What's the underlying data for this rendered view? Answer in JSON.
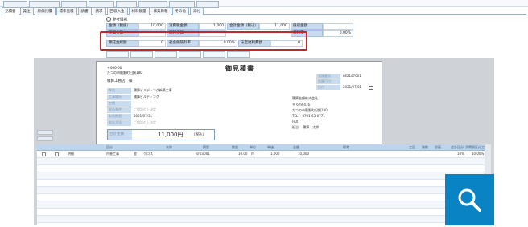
{
  "tabs": [
    "見積書",
    "発注",
    "原価見積",
    "標準見積",
    "請書",
    "請求",
    "回収入金",
    "材料数量",
    "作業日報",
    "その他",
    "添付"
  ],
  "section_toggle_label": "参考情報",
  "reference_fields": [
    {
      "label": "金額（税抜）",
      "value": "10,000"
    },
    {
      "label": "消費税金額",
      "value": "1,000"
    },
    {
      "label": "合計金額（税込）",
      "value": "11,000"
    },
    {
      "label": "値引金額",
      "value": ""
    },
    {
      "label": "原価金額",
      "value": ""
    },
    {
      "label": "粗利金額",
      "value": ""
    },
    {
      "label": "粗利率",
      "value": "0.00%"
    }
  ],
  "highlight_fields": [
    {
      "label": "預託金総額",
      "value": "0"
    },
    {
      "label": "社会保険料率",
      "value": "0.00%"
    },
    {
      "label": "法定福利費額",
      "value": "0"
    }
  ],
  "document": {
    "title": "御見積書",
    "address_line1": "〒000-00",
    "address_line2": "たつの市龍野町日飼180",
    "recipient": "積算工務店　様",
    "fields": [
      {
        "label": "件名",
        "value": "積算ビルディング新築工事"
      },
      {
        "label": "工事場所",
        "value": "積算ビルディング"
      },
      {
        "label": "工期",
        "value": ""
      },
      {
        "label": "支払条件",
        "value": "ご相談の上決定"
      },
      {
        "label": "有効期限",
        "value": "2021/07/31"
      },
      {
        "label": "支払方法",
        "value": "ご相談の上決定"
      }
    ],
    "meta": [
      {
        "label": "見積番号",
        "value": "PE2107001"
      },
      {
        "label": "見積日付",
        "value": ""
      },
      {
        "label": "日付",
        "value": "2021/07/01"
      }
    ],
    "company": {
      "name": "積算金額株式会社",
      "postal": "〒 679-4167",
      "address": "たつの市龍野町日飼180",
      "tel": "TEL： 0791-63-0771",
      "fax": "FAX：",
      "contact": "担当： 積算　太郎"
    },
    "total_label": "合計金額",
    "total_value": "11,000円",
    "total_note": "（税込）"
  },
  "table": {
    "headers": [
      "区分",
      "名称",
      "摘要",
      "数量",
      "単位",
      "単価",
      "金額",
      "備考"
    ],
    "right_headers": [
      "工区",
      "階数",
      "部屋",
      "会計区分",
      "消費税区分",
      "工事番号"
    ],
    "rows": [
      {
        "kubun": "内装工事",
        "sub": "壁",
        "name": "クロス",
        "spec": "sncx001",
        "qty": "10.00",
        "unit": "m",
        "price": "1,000",
        "amount": "10,000",
        "tax": "10%",
        "rate": "10.00%"
      }
    ]
  },
  "left_tag": "明細",
  "zoom_icon": "search-icon"
}
